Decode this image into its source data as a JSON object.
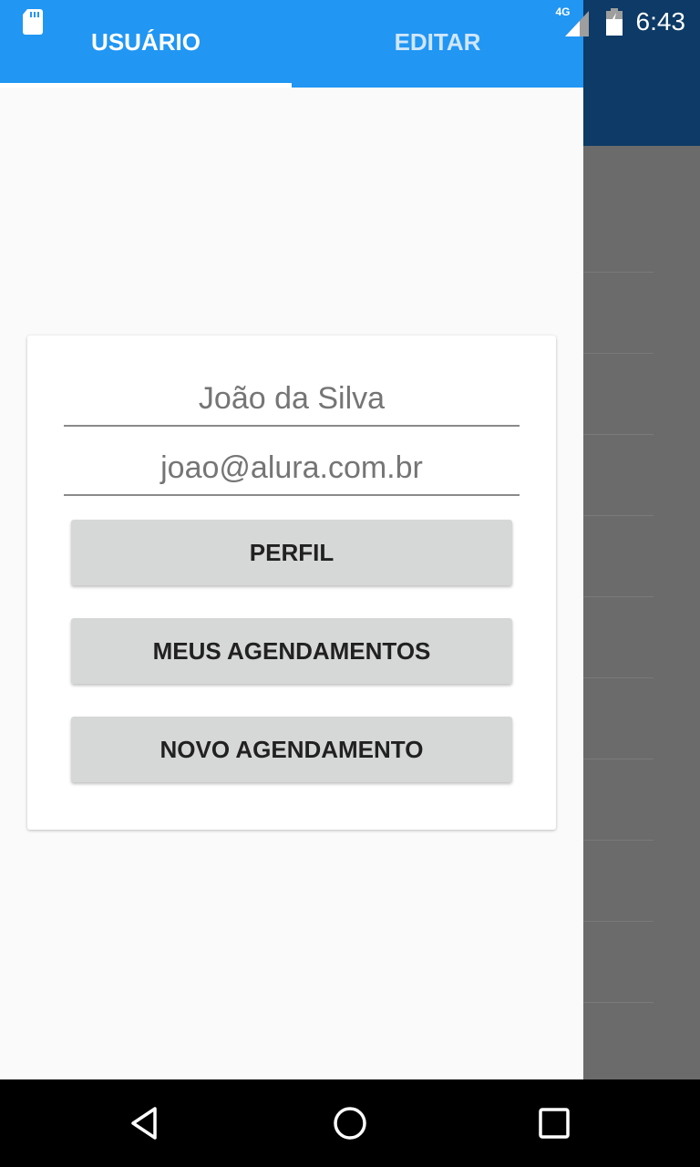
{
  "status_bar": {
    "network_type": "4G",
    "time": "6:43",
    "icons": [
      "sd-card-icon",
      "signal-icon",
      "battery-icon"
    ]
  },
  "drawer": {
    "tabs": [
      {
        "label": "USUÁRIO",
        "selected": true
      },
      {
        "label": "EDITAR",
        "selected": false
      }
    ]
  },
  "card": {
    "name": "João da Silva",
    "email": "joao@alura.com.br",
    "buttons": {
      "perfil": "PERFIL",
      "meus_agendamentos": "MEUS AGENDAMENTOS",
      "novo_agendamento": "NOVO AGENDAMENTO"
    }
  },
  "nav_bar": {
    "icons": [
      "back-icon",
      "home-icon",
      "recents-icon"
    ]
  },
  "colors": {
    "tab_bar": "#2196f3",
    "button_bg": "#d6d7d7",
    "background_toolbar": "#0d3a66",
    "scrim": "#6b6b6b"
  }
}
